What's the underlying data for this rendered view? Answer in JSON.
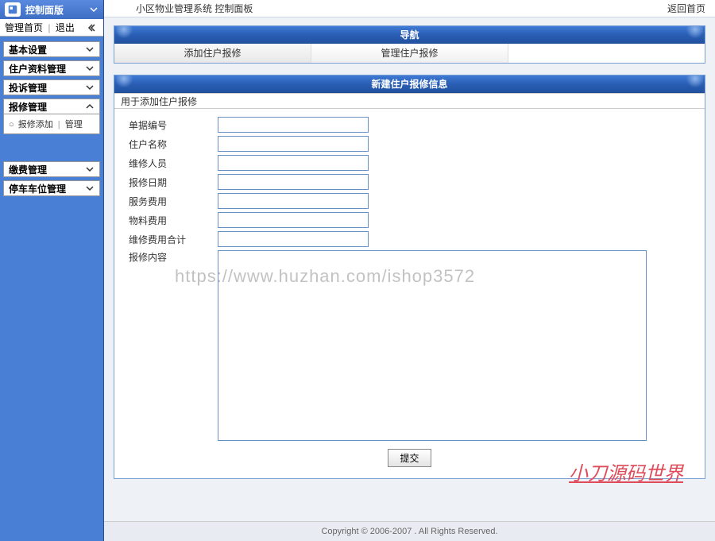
{
  "sidebar": {
    "control_panel": "控制面版",
    "home_link": "管理首页",
    "logout": "退出",
    "groups": [
      {
        "label": "基本设置",
        "expanded": false
      },
      {
        "label": "住户资料管理",
        "expanded": false
      },
      {
        "label": "投诉管理",
        "expanded": false
      },
      {
        "label": "报修管理",
        "expanded": true,
        "sub": {
          "add": "报修添加",
          "manage": "管理"
        }
      },
      {
        "label": "缴费管理",
        "expanded": false
      },
      {
        "label": "停车车位管理",
        "expanded": false
      }
    ]
  },
  "topbar": {
    "breadcrumb": "小区物业管理系统 控制面板",
    "back_home": "返回首页"
  },
  "nav_panel": {
    "title": "导航",
    "tabs": [
      "添加住户报修",
      "管理住户报修"
    ]
  },
  "form_panel": {
    "title": "新建住户报修信息",
    "hint": "用于添加住户报修",
    "fields": {
      "order_no": "单据编号",
      "resident_name": "住户名称",
      "repairman": "维修人员",
      "repair_date": "报修日期",
      "service_fee": "服务费用",
      "material_fee": "物料费用",
      "total_fee": "维修费用合计",
      "content": "报修内容"
    },
    "submit": "提交"
  },
  "footer": "Copyright © 2006-2007 . All Rights Reserved.",
  "watermarks": {
    "url": "https://www.huzhan.com/ishop3572",
    "brand": "小刀源码世界"
  }
}
